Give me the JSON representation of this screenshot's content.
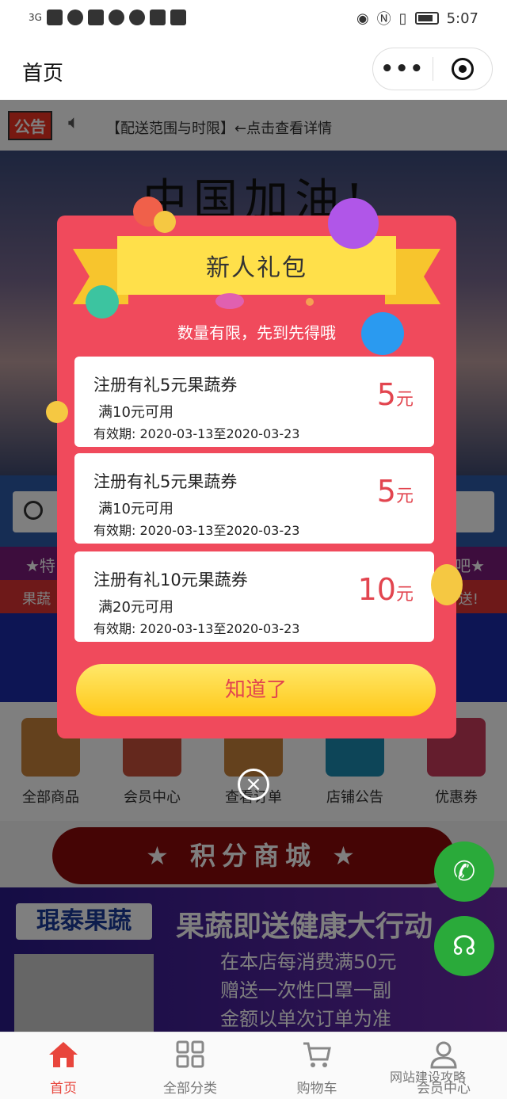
{
  "status_bar": {
    "network": "3G",
    "time": "5:07"
  },
  "nav": {
    "title": "首页",
    "more_icon": "more-dots-icon",
    "close_icon": "target-icon"
  },
  "notice": {
    "tag": "公告",
    "text": "【配送范围与时限】←点击查看详情"
  },
  "banner": {
    "headline": "中国加油!"
  },
  "ticker": {
    "line1": "★特",
    "line1_end": "吧★",
    "line2": "果蔬",
    "line2_end": "送!"
  },
  "quick_menu": [
    {
      "label": "全部商品",
      "icon": "document-icon",
      "color": "#c8823a"
    },
    {
      "label": "会员中心",
      "icon": "shirt-icon",
      "color": "#c8503a"
    },
    {
      "label": "查看订单",
      "icon": "basket-icon",
      "color": "#c8823a"
    },
    {
      "label": "店铺公告",
      "icon": "chat-icon",
      "color": "#1a8ab0"
    },
    {
      "label": "优惠券",
      "icon": "gift-icon",
      "color": "#c83a5a"
    }
  ],
  "points_mall": {
    "label": "★ 积分商城 ★"
  },
  "lower_banner": {
    "logo": "琨泰果蔬",
    "title": "果蔬即送健康大行动",
    "lines": [
      "在本店每消费满50元",
      "赠送一次性口罩一副",
      "金额以单次订单为准"
    ]
  },
  "popup": {
    "title": "新人礼包",
    "subtitle": "数量有限，先到先得哦",
    "coupons": [
      {
        "name": "注册有礼5元果蔬券",
        "condition": "满10元可用",
        "validity": "有效期: 2020-03-13至2020-03-23",
        "amount": "5",
        "unit": "元"
      },
      {
        "name": "注册有礼5元果蔬券",
        "condition": "满10元可用",
        "validity": "有效期: 2020-03-13至2020-03-23",
        "amount": "5",
        "unit": "元"
      },
      {
        "name": "注册有礼10元果蔬券",
        "condition": "满20元可用",
        "validity": "有效期: 2020-03-13至2020-03-23",
        "amount": "10",
        "unit": "元"
      }
    ],
    "ok_button": "知道了",
    "close_glyph": "×"
  },
  "float_buttons": {
    "phone_icon": "phone-icon",
    "service_icon": "headset-icon"
  },
  "tabs": [
    {
      "label": "首页",
      "icon": "home-icon",
      "active": true
    },
    {
      "label": "全部分类",
      "icon": "grid-icon",
      "active": false
    },
    {
      "label": "购物车",
      "icon": "cart-icon",
      "active": false
    },
    {
      "label": "会员中心",
      "icon": "user-icon",
      "active": false
    }
  ],
  "watermark": "网站建设攻略",
  "colors": {
    "accent": "#e8453c",
    "popup_bg": "#f04a5c",
    "ribbon": "#ffe04a",
    "amount": "#e2454f"
  }
}
